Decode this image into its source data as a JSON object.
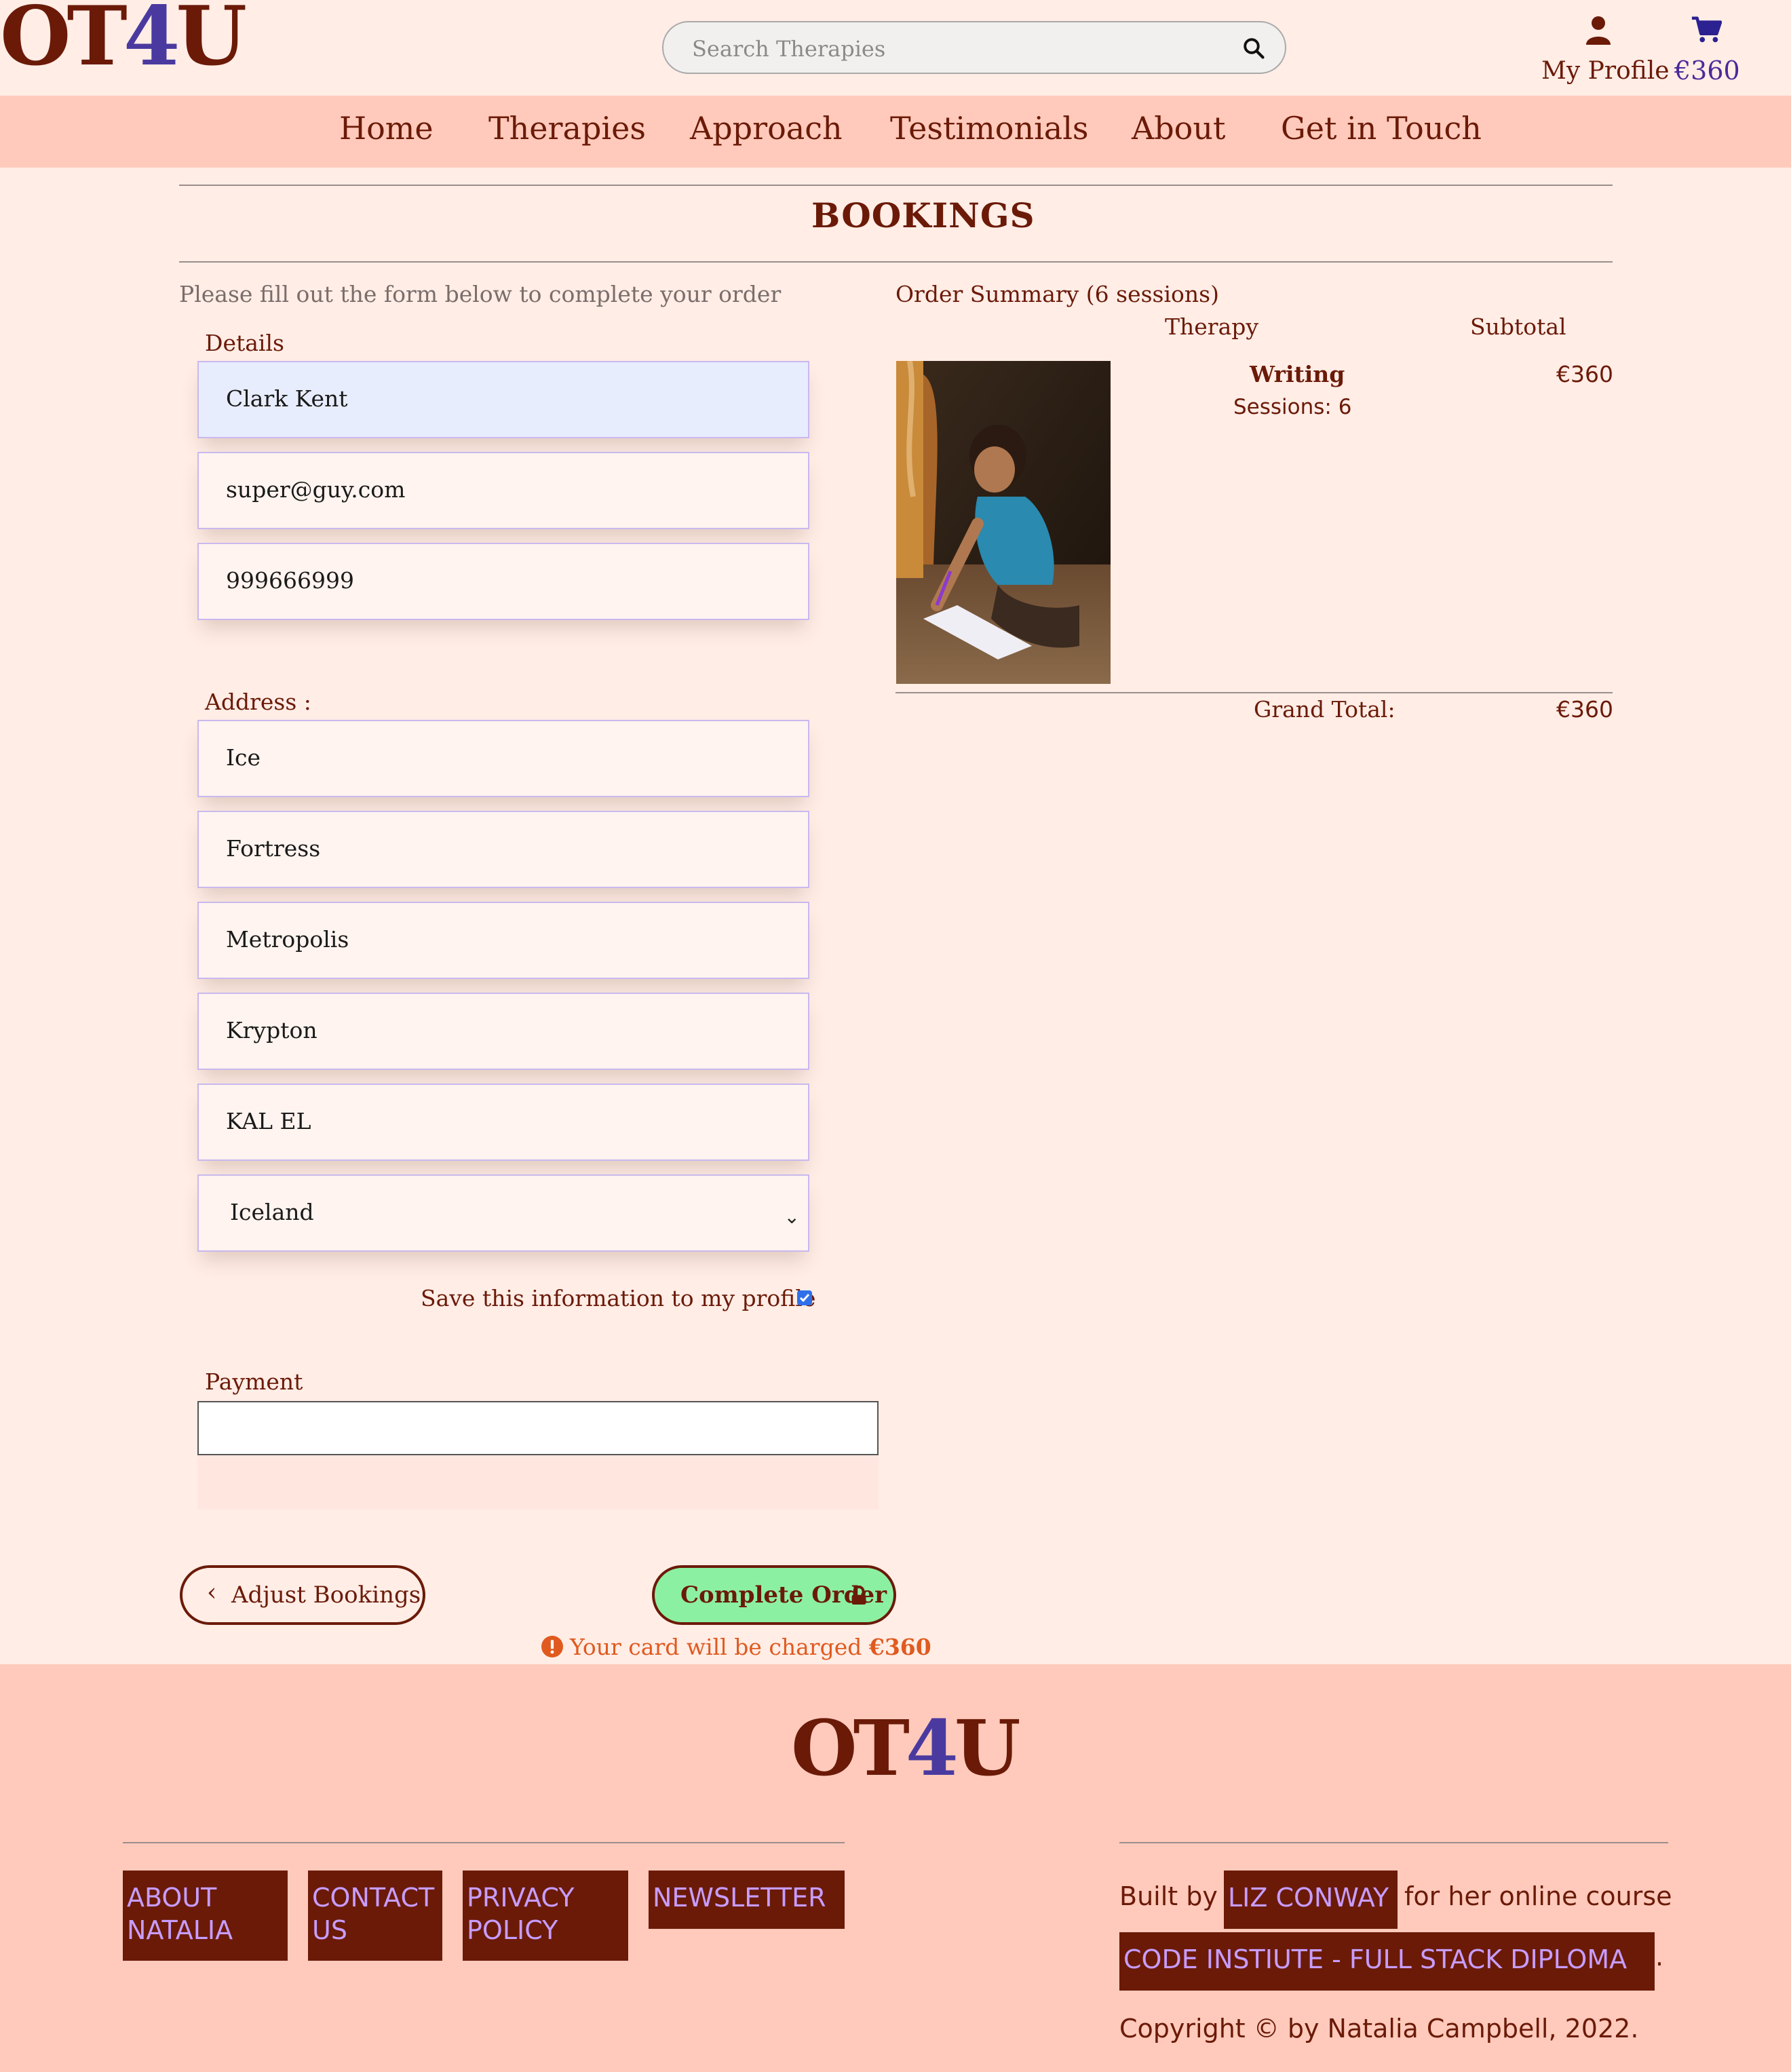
{
  "header": {
    "logo": {
      "a": "OT",
      "b": "4",
      "c": "U"
    },
    "search_placeholder": "Search Therapies",
    "profile_label": "My Profile",
    "cart_total": "€360"
  },
  "nav": [
    "Home",
    "Therapies",
    "Approach",
    "Testimonials",
    "About",
    "Get in Touch"
  ],
  "page": {
    "title": "BOOKINGS",
    "form_intro": "Please fill out the form below to complete your order",
    "details_label": "Details",
    "details": {
      "full_name": "Clark Kent",
      "email": "super@guy.com",
      "phone": "999666999"
    },
    "address_label": "Address :",
    "address": {
      "street1": "Ice",
      "street2": "Fortress",
      "town": "Metropolis",
      "county": "Krypton",
      "postcode": "KAL EL",
      "country": "Iceland"
    },
    "save_info_label": "Save this information to my profile",
    "save_info_checked": true,
    "payment_label": "Payment",
    "adjust_button": "Adjust Bookings",
    "complete_button": "Complete Order",
    "charge_text": "Your card will be charged",
    "charge_amount": "€360"
  },
  "summary": {
    "heading": "Order Summary (6 sessions)",
    "col_therapy": "Therapy",
    "col_subtotal": "Subtotal",
    "item": {
      "name": "Writing",
      "sessions": "Sessions: 6",
      "subtotal": "€360"
    },
    "grand_total_label": "Grand Total:",
    "grand_total": "€360"
  },
  "footer": {
    "logo": {
      "a": "OT",
      "b": "4",
      "c": "U"
    },
    "links": {
      "about": [
        "ABOUT",
        "NATALIA"
      ],
      "contact": [
        "CONTACT",
        "US"
      ],
      "privacy": [
        "PRIVACY",
        "POLICY"
      ],
      "newsletter": "NEWSLETTER"
    },
    "built_by": "Built by",
    "author": "LIZ CONWAY",
    "course_text": "for her online course",
    "course_link": "CODE INSTIUTE - FULL STACK DIPLOMA",
    "period": ".",
    "copyright": "Copyright © by Natalia Campbell, 2022."
  },
  "colors": {
    "page_bg": "#ffede6",
    "nav_bg": "#ffcabb",
    "brand": "#6b1a08",
    "accent_purple": "#4a3aa0",
    "complete_btn": "#8cf0a3",
    "warning": "#e05a1f"
  },
  "icons": [
    "search-icon",
    "user-icon",
    "cart-icon",
    "chevron-left-icon",
    "lock-icon",
    "exclamation-icon",
    "chevron-down-icon"
  ]
}
